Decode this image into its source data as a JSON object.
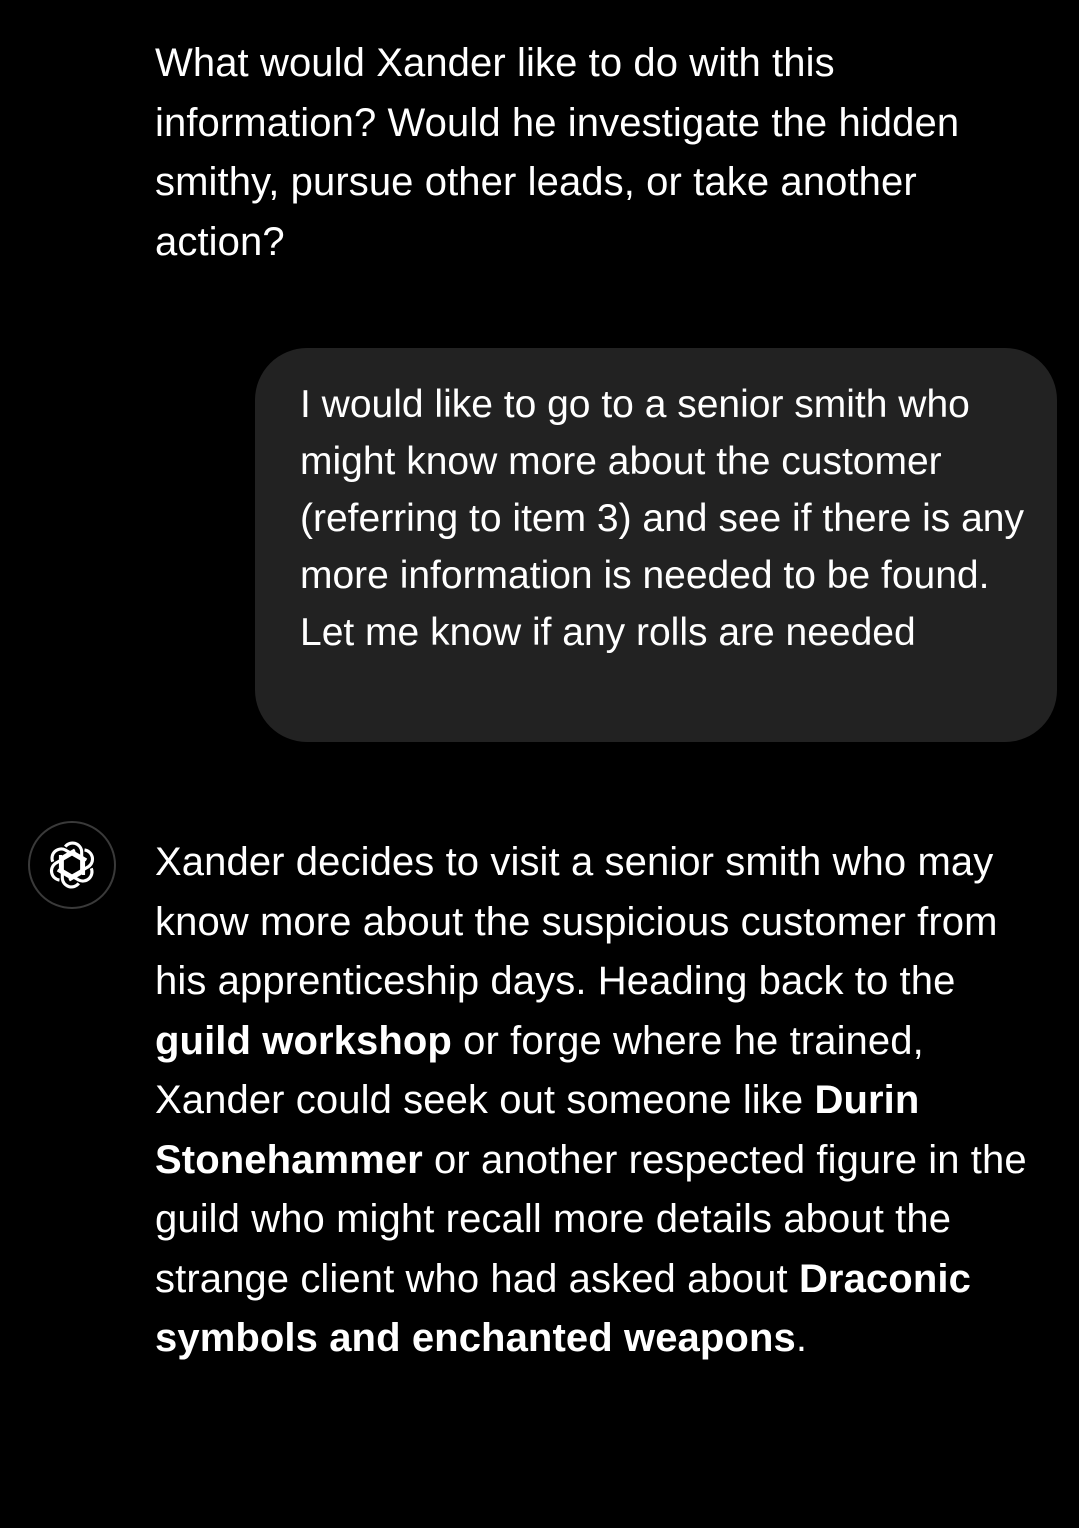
{
  "colors": {
    "background": "#000000",
    "user_bubble": "#222222",
    "text": "#ffffff",
    "avatar_border": "#3a3a3a"
  },
  "conversation": {
    "assistant_prev": {
      "text": "What would Xander like to do with this information? Would he investigate the hidden smithy, pursue other leads, or take another action?"
    },
    "user_message": {
      "text": "I would like to go to a senior smith who might know more about the customer (referring to item 3) and see if there is any more information is needed to be found. Let me know if any rolls are needed"
    },
    "assistant_reply": {
      "avatar_icon": "openai-logo-icon",
      "parts": [
        "Xander decides to visit a senior smith who may know more about the suspicious customer from his apprenticeship days. Heading back to the ",
        "guild workshop",
        " or forge where he trained, Xander could seek out someone like ",
        "Durin Stonehammer",
        " or another respected figure in the guild who might recall more details about the strange client who had asked about ",
        "Draconic symbols and enchanted weapons",
        "."
      ]
    }
  }
}
